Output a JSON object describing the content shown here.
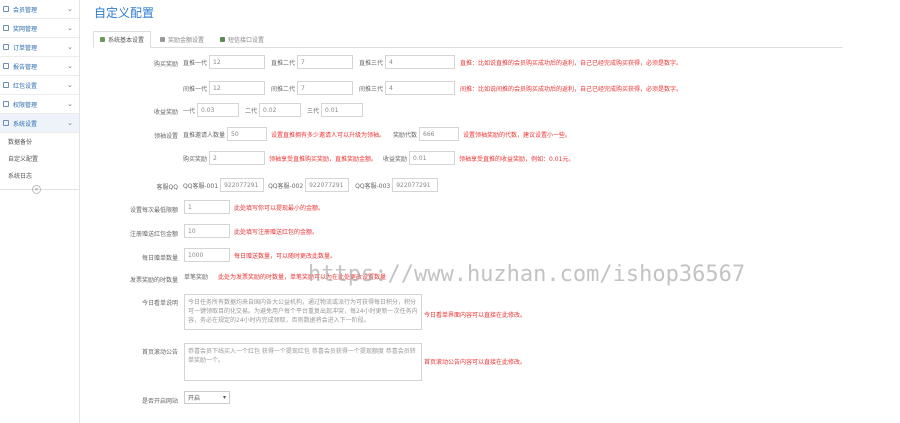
{
  "sidebar": {
    "items": [
      {
        "label": "会员管理"
      },
      {
        "label": "奖网管理"
      },
      {
        "label": "订单管理"
      },
      {
        "label": "报告管理"
      },
      {
        "label": "红包设置"
      },
      {
        "label": "权限管理"
      },
      {
        "label": "系统设置"
      }
    ],
    "sub_items": [
      {
        "label": "数据备份"
      },
      {
        "label": "自定义配置"
      },
      {
        "label": "系统日志"
      }
    ],
    "collapse": "«"
  },
  "page_title": "自定义配置",
  "tabs": [
    {
      "label": "系统基本设置"
    },
    {
      "label": "奖励金额设置"
    },
    {
      "label": "短信接口设置"
    }
  ],
  "form": {
    "r1": {
      "label": "购买奖励",
      "a": {
        "sub": "直推一代",
        "val": "12"
      },
      "b": {
        "sub": "直推二代",
        "val": "7"
      },
      "c": {
        "sub": "直推三代",
        "val": "4"
      },
      "hint": "直推：比如说直推的会员购买成功后的返利，自己已经完成购买获得，必须是数字。"
    },
    "r2": {
      "a": {
        "sub": "间推一代",
        "val": "12"
      },
      "b": {
        "sub": "间推二代",
        "val": "7"
      },
      "c": {
        "sub": "间推三代",
        "val": "4"
      },
      "hint": "间推：比如说间推的会员购买成功后的返利，自己已经完成购买获得，必须是数字。"
    },
    "r3": {
      "label": "收益奖励",
      "a": {
        "sub": "一代",
        "val": "0.03"
      },
      "b": {
        "sub": "二代",
        "val": "0.02"
      },
      "c": {
        "sub": "三代",
        "val": "0.01"
      }
    },
    "r4": {
      "label": "领袖设置",
      "a": {
        "sub": "直推邀请人数量",
        "val": "50"
      },
      "hint_a": "设置直推拥有多少邀请人可以升级为领袖。",
      "b": {
        "sub": "奖励代数",
        "val": "666"
      },
      "hint_b": "设置领袖奖励的代数，建议设置小一些。"
    },
    "r5": {
      "a": {
        "sub": "购买奖励",
        "val": "2"
      },
      "hint_a": "领袖享受直推购买奖励，直推奖励金额。",
      "b": {
        "sub": "收益奖励",
        "val": "0.01"
      },
      "hint_b": "领袖享受直推的收益奖励，例如：0.01元。"
    },
    "r6": {
      "label": "客服QQ",
      "a": {
        "sub": "QQ客服-001",
        "val": "922077291"
      },
      "b": {
        "sub": "QQ客服-002",
        "val": "922077291"
      },
      "c": {
        "sub": "QQ客服-003",
        "val": "922077291"
      }
    },
    "r7": {
      "label": "设置每次最低限额",
      "val": "1",
      "hint": "此处填写你可以提现最小的金额。"
    },
    "r8": {
      "label": "注册赠送红包金额",
      "val": "10",
      "hint": "此处填写注册赠送红包的金额。"
    },
    "r9": {
      "label": "每日赠单数量",
      "val": "1000",
      "hint": "每日赠送数量，可以随时更改此数量。"
    },
    "r10": {
      "label": "发票奖励的时数量",
      "sub": "单笔奖励",
      "hint": "此处为发票奖励的时数量，单笔奖励可以为在此处更改设置数量"
    },
    "r11": {
      "label": "今日看单说明",
      "text": "今日任务所有数据均来自国内各大公益机构，通过物流或派行为可获得每日积分，积分可一键领取目的化交易。为避免用户每个平台重复出现冲突，每24小时更新一次任务内容，务必在规定的24小时内完成领取，否则数据将会进入下一阶段。",
      "hint": "今日看单界面内容可以直接在此修改。"
    },
    "r12": {
      "label": "首页滚动公告",
      "text": "恭喜会员下线买入一个红包 获得一个提现红包 恭喜会员获得一个提现额度 恭喜会员转单奖励一个。",
      "hint": "首页滚动公告内容可以直接在此修改。"
    },
    "r13": {
      "label": "是否开启网站",
      "val": "开启"
    }
  },
  "watermark": "https://www.huzhan.com/ishop36567"
}
